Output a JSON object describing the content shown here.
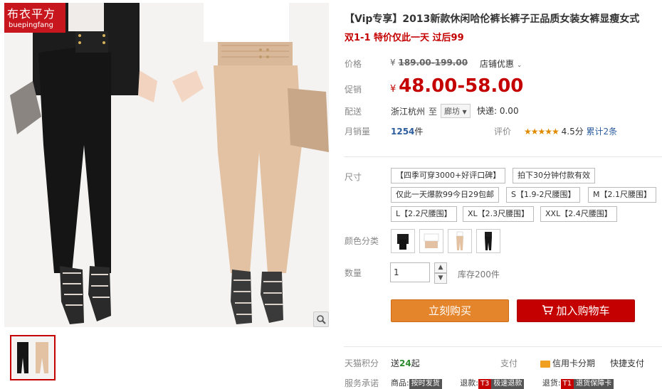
{
  "brand": {
    "name_cn": "布衣平方",
    "name_en": "buepingfang"
  },
  "gallery": {
    "zoom_icon": "magnifier-icon"
  },
  "product": {
    "title": "【Vip专享】2013新款休闲哈伦裤长裤子正品质女装女裤显瘦女式",
    "subtitle": "双1-1 特价仅此一天 过后99"
  },
  "price": {
    "label": "价格",
    "currency": "¥",
    "original": "189.00-199.00",
    "shop_discount": "店铺优惠"
  },
  "promo": {
    "label": "促销",
    "currency": "¥",
    "price": "48.00-58.00"
  },
  "shipping": {
    "label": "配送",
    "from": "浙江杭州",
    "to_word": "至",
    "destination": "廊坊",
    "express": "快递: 0.00"
  },
  "sales": {
    "monthly_label": "月销量",
    "monthly_value": "1254",
    "unit": "件",
    "rating_label": "评价",
    "stars": "★★★★★",
    "rating": "4.5分",
    "reviews": "累计2条",
    "rating_value": 4.5
  },
  "size": {
    "label": "尺寸",
    "options": [
      "【四季可穿3000+好评口碑】",
      "拍下30分钟付款有效",
      "仅此一天爆款99今日29包邮",
      "S【1.9-2尺腰围】",
      "M【2.1尺腰围】",
      "L【2.2尺腰围】",
      "XL【2.3尺腰围】",
      "XXL【2.4尺腰围】"
    ]
  },
  "color": {
    "label": "颜色分类",
    "swatches": [
      "black",
      "beige-top",
      "beige",
      "black-full"
    ]
  },
  "quantity": {
    "label": "数量",
    "value": "1",
    "up": "▲",
    "down": "▼",
    "stock": "库存200件"
  },
  "actions": {
    "buy_now": "立刻购买",
    "add_to_cart": "加入购物车",
    "cart_icon": "cart-icon"
  },
  "footer": {
    "points_label": "天猫积分",
    "points_text": "送",
    "points_value": "24",
    "points_suffix": "起",
    "pay_label": "支付",
    "credit": "信用卡分期",
    "quick_pay": "快捷支付",
    "service_label": "服务承诺",
    "goods_label": "商品:",
    "goods_badge": "按时发货",
    "refund_label": "退款:",
    "refund_badge_code": "T3",
    "refund_badge": "极速退款",
    "return_label": "退货:",
    "return_badge_code": "T1",
    "return_badge": "退货保障卡"
  },
  "colors": {
    "accent_red": "#c40000",
    "buy_orange": "#e5852b"
  }
}
